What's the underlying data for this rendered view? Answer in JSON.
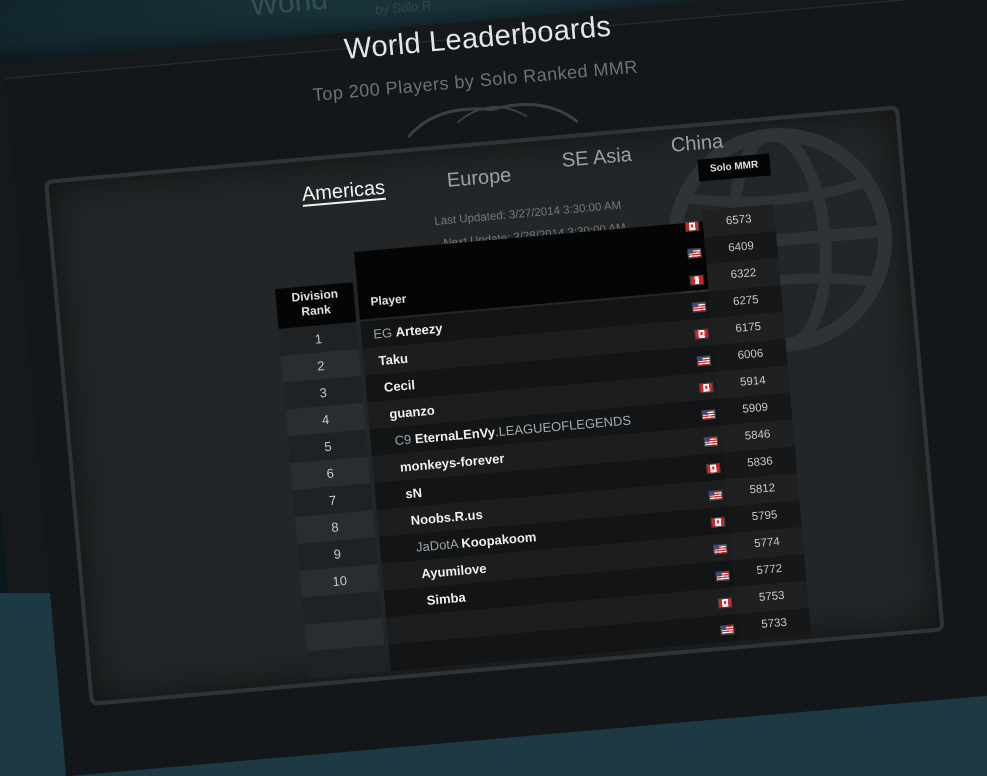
{
  "ghost": {
    "title": "World",
    "subtitle": "by Solo R"
  },
  "header": {
    "title": "World Leaderboards",
    "subtitle": "Top 200 Players by Solo Ranked MMR"
  },
  "tabs": [
    {
      "label": "Americas",
      "active": true
    },
    {
      "label": "Europe",
      "active": false
    },
    {
      "label": "SE Asia",
      "active": false
    },
    {
      "label": "China",
      "active": false
    }
  ],
  "update_info": {
    "last": "Last Updated: 3/27/2014 3:30:00 AM",
    "next": "Next Update: 3/28/2014 3:30:00 AM"
  },
  "table": {
    "col_rank": "Division Rank",
    "col_rank_line1": "Division",
    "col_rank_line2": "Rank",
    "col_player": "Player",
    "col_mmr": "Solo MMR",
    "rows": [
      {
        "rank": "",
        "team": "",
        "name": "",
        "suffix": "",
        "flag": "ca",
        "mmr": "6573"
      },
      {
        "rank": "",
        "team": "",
        "name": "",
        "suffix": "",
        "flag": "us",
        "mmr": "6409"
      },
      {
        "rank": "",
        "team": "",
        "name": "",
        "suffix": "",
        "flag": "pe",
        "mmr": "6322"
      },
      {
        "rank": "1",
        "team": "EG ",
        "name": "Arteezy",
        "suffix": "",
        "flag": "us",
        "mmr": "6275"
      },
      {
        "rank": "2",
        "team": "",
        "name": "Taku",
        "suffix": "",
        "flag": "ca",
        "mmr": "6175"
      },
      {
        "rank": "3",
        "team": "",
        "name": "Cecil",
        "suffix": "",
        "flag": "us",
        "mmr": "6006"
      },
      {
        "rank": "4",
        "team": "",
        "name": "guanzo",
        "suffix": "",
        "flag": "ca",
        "mmr": "5914"
      },
      {
        "rank": "5",
        "team": "C9 ",
        "name": "EternaLEnVy",
        "suffix": ".LEAGUEOFLEGENDS",
        "flag": "us",
        "mmr": "5909"
      },
      {
        "rank": "6",
        "team": "",
        "name": "monkeys-forever",
        "suffix": "",
        "flag": "us",
        "mmr": "5846"
      },
      {
        "rank": "7",
        "team": "",
        "name": "sN",
        "suffix": "",
        "flag": "ca",
        "mmr": "5836"
      },
      {
        "rank": "8",
        "team": "",
        "name": "Noobs.R.us",
        "suffix": "",
        "flag": "us",
        "mmr": "5812"
      },
      {
        "rank": "9",
        "team": "JaDotA ",
        "name": "Koopakoom",
        "suffix": "",
        "flag": "ca",
        "mmr": "5795"
      },
      {
        "rank": "10",
        "team": "",
        "name": "Ayumilove",
        "suffix": "",
        "flag": "us",
        "mmr": "5774"
      },
      {
        "rank": "",
        "team": "",
        "name": "Simba",
        "suffix": "",
        "flag": "us",
        "mmr": "5772"
      },
      {
        "rank": "",
        "team": "",
        "name": "",
        "suffix": "",
        "flag": "ca",
        "mmr": "5753"
      },
      {
        "rank": "",
        "team": "",
        "name": "",
        "suffix": "",
        "flag": "us",
        "mmr": "5733"
      }
    ]
  }
}
